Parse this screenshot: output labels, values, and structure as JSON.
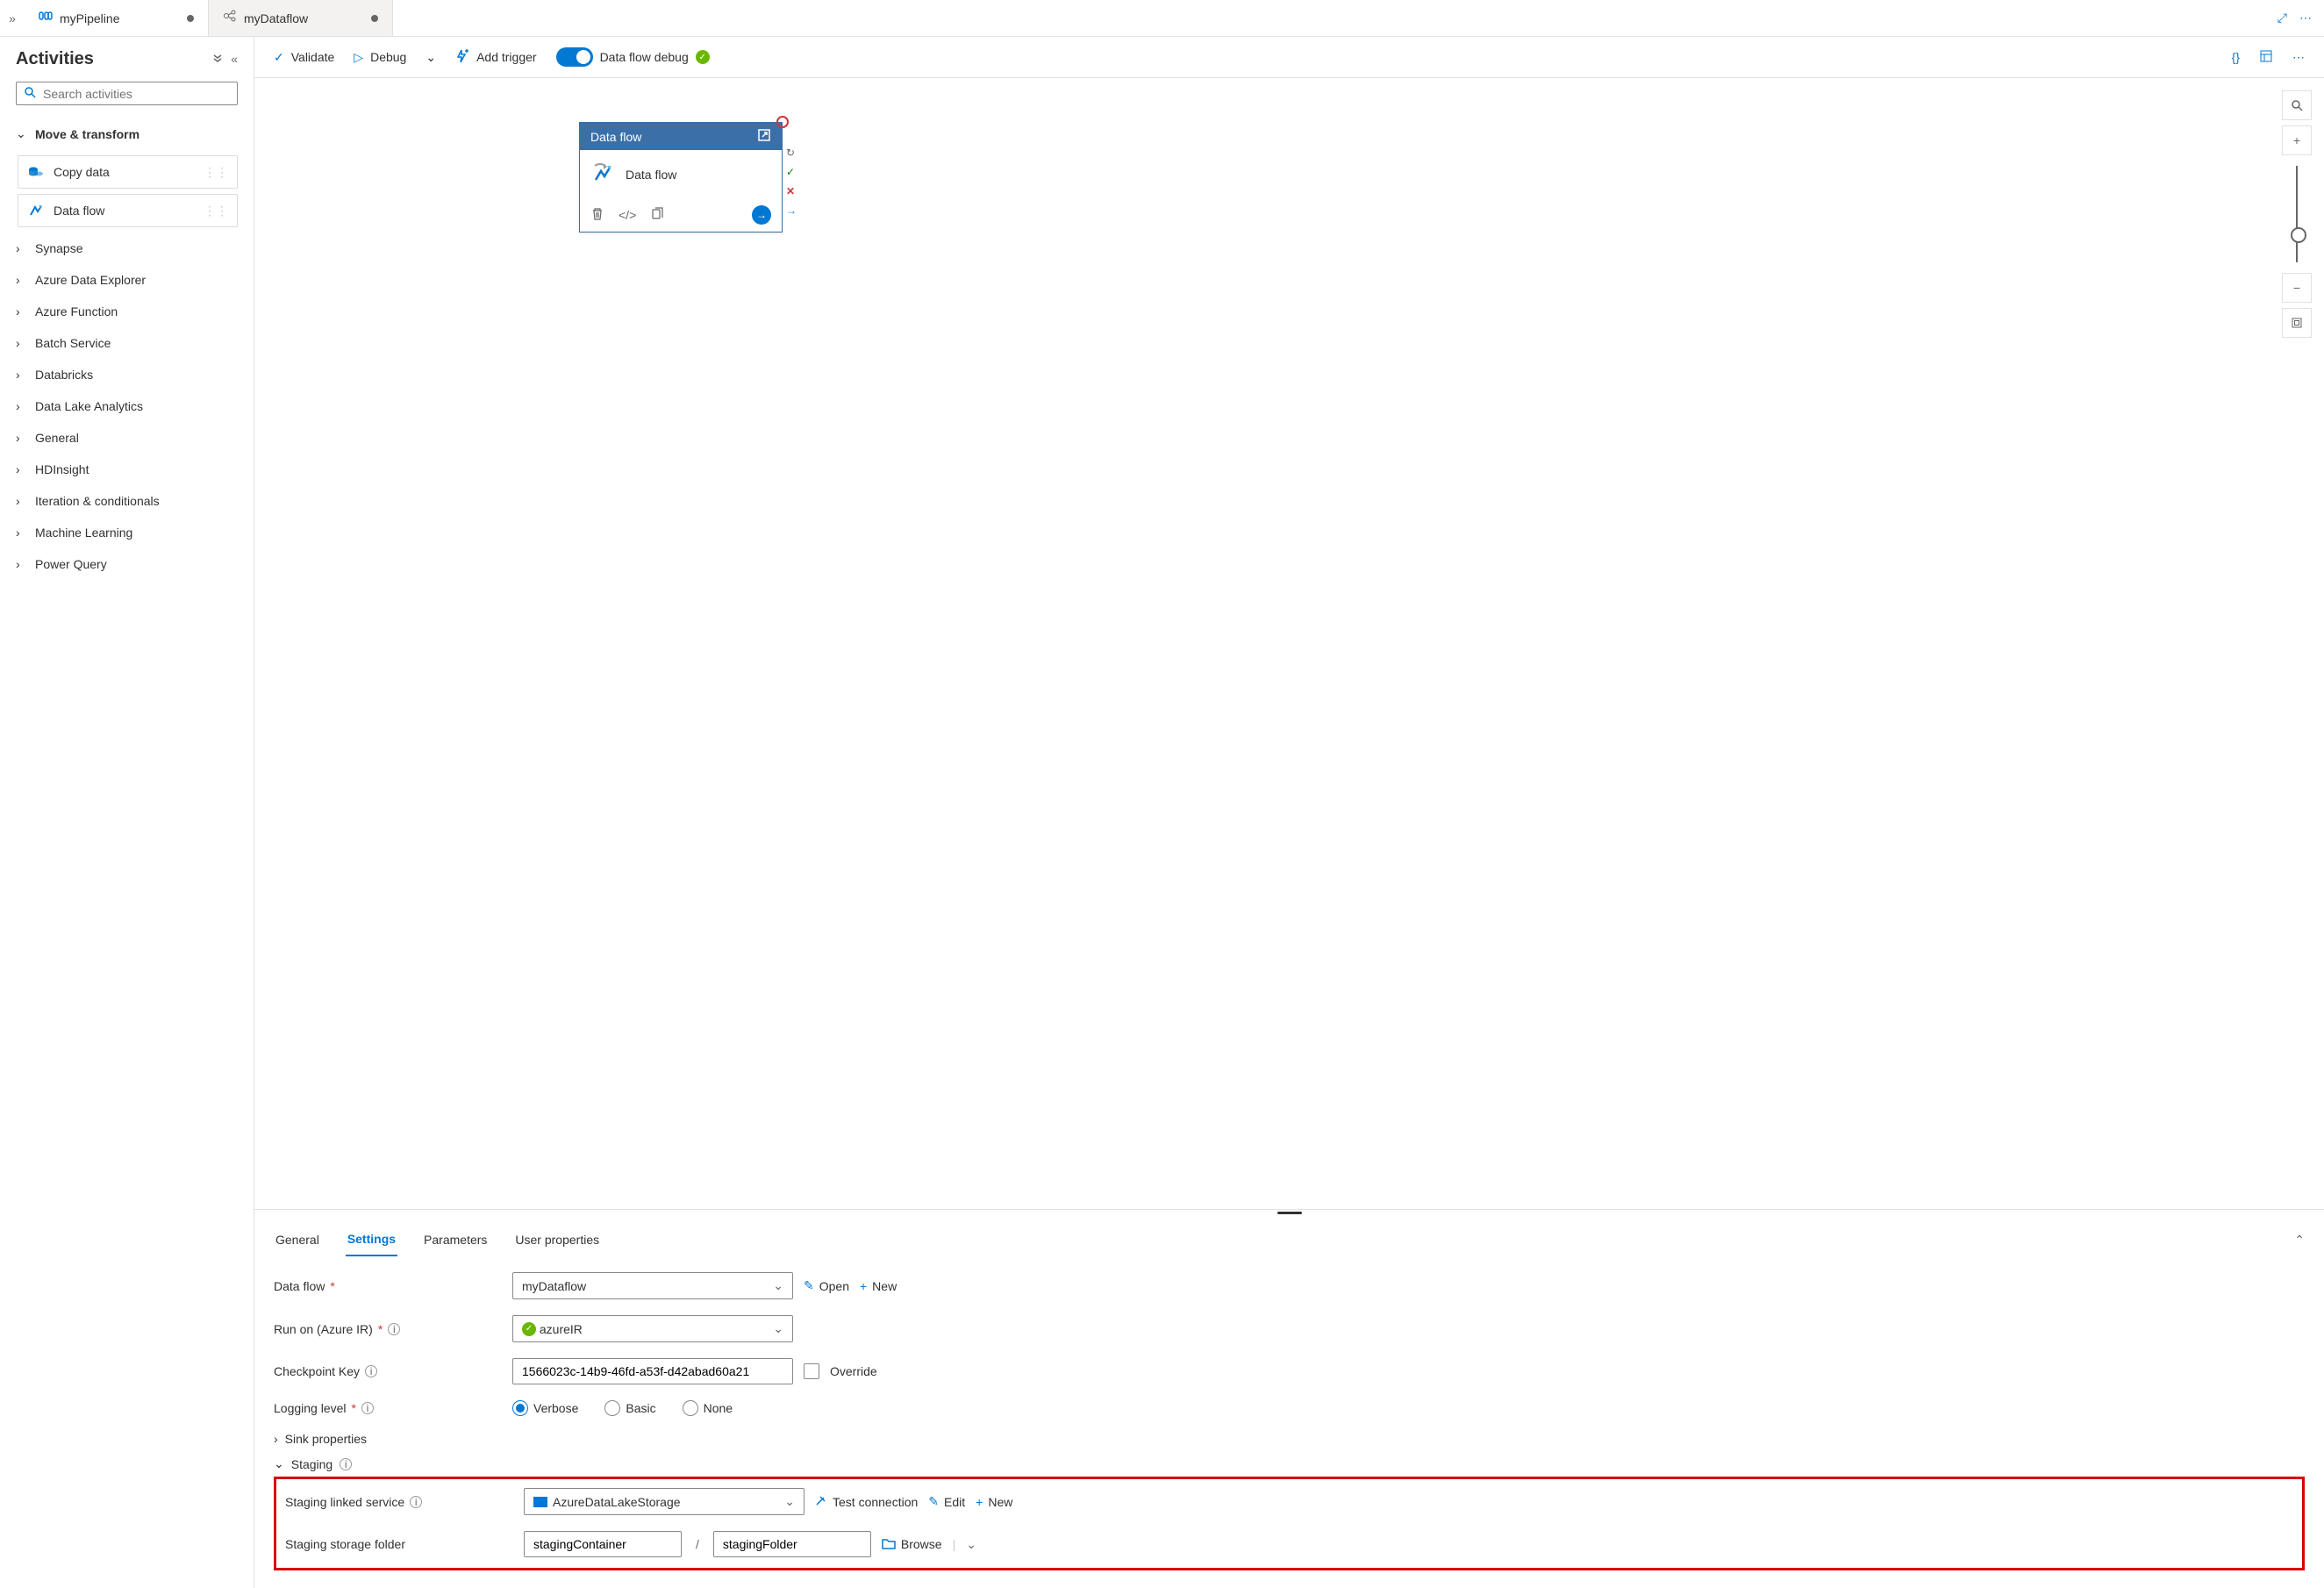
{
  "tabs": [
    {
      "label": "myPipeline",
      "dirty": true
    },
    {
      "label": "myDataflow",
      "dirty": true
    }
  ],
  "sidebar": {
    "title": "Activities",
    "search_placeholder": "Search activities",
    "open_category": "Move & transform",
    "items": [
      {
        "label": "Copy data"
      },
      {
        "label": "Data flow"
      }
    ],
    "categories": [
      "Synapse",
      "Azure Data Explorer",
      "Azure Function",
      "Batch Service",
      "Databricks",
      "Data Lake Analytics",
      "General",
      "HDInsight",
      "Iteration & conditionals",
      "Machine Learning",
      "Power Query"
    ]
  },
  "toolbar": {
    "validate": "Validate",
    "debug": "Debug",
    "add_trigger": "Add trigger",
    "debug_toggle": "Data flow debug"
  },
  "node": {
    "title": "Data flow",
    "subtitle": "Data flow"
  },
  "panel": {
    "tabs": [
      "General",
      "Settings",
      "Parameters",
      "User properties"
    ],
    "active": "Settings",
    "dataflow_label": "Data flow",
    "dataflow_value": "myDataflow",
    "open": "Open",
    "new": "New",
    "run_on_label": "Run on (Azure IR)",
    "run_on_value": "azureIR",
    "checkpoint_label": "Checkpoint Key",
    "checkpoint_value": "1566023c-14b9-46fd-a53f-d42abad60a21",
    "override": "Override",
    "logging_label": "Logging level",
    "logging_options": [
      "Verbose",
      "Basic",
      "None"
    ],
    "sink_properties": "Sink properties",
    "staging": "Staging",
    "staging_linked_label": "Staging linked service",
    "staging_linked_value": "AzureDataLakeStorage",
    "test_conn": "Test connection",
    "edit": "Edit",
    "staging_folder_label": "Staging storage folder",
    "staging_container": "stagingContainer",
    "staging_folder": "stagingFolder",
    "browse": "Browse"
  }
}
